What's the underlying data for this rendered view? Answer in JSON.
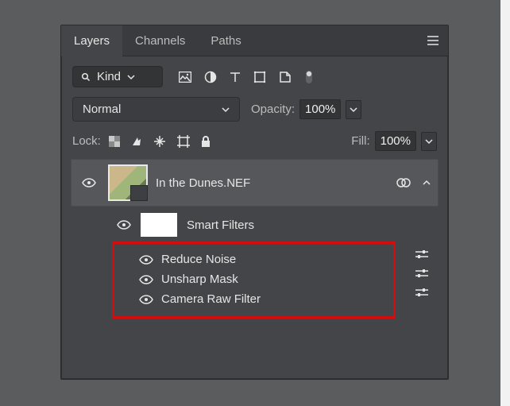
{
  "tabs": {
    "layers": "Layers",
    "channels": "Channels",
    "paths": "Paths"
  },
  "filterRow": {
    "kindLabel": "Kind"
  },
  "blend": {
    "mode": "Normal",
    "opacityLabel": "Opacity:",
    "opacityValue": "100%"
  },
  "lockRow": {
    "label": "Lock:",
    "fillLabel": "Fill:",
    "fillValue": "100%"
  },
  "layer": {
    "name": "In the Dunes.NEF"
  },
  "smartFilters": {
    "label": "Smart Filters",
    "items": [
      {
        "name": "Reduce Noise"
      },
      {
        "name": "Unsharp Mask"
      },
      {
        "name": "Camera Raw Filter"
      }
    ]
  },
  "highlightColor": "#d40c0c"
}
